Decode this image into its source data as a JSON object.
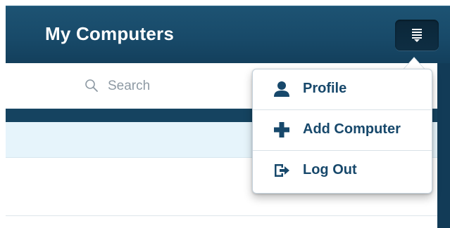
{
  "header": {
    "title": "My Computers",
    "menu_icon": "menu-list-icon"
  },
  "search": {
    "icon": "search-icon",
    "placeholder": "Search"
  },
  "dropdown_menu": {
    "items": [
      {
        "label": "Profile",
        "icon": "person-icon"
      },
      {
        "label": "Add Computer",
        "icon": "plus-icon"
      },
      {
        "label": "Log Out",
        "icon": "logout-icon"
      }
    ]
  },
  "colors": {
    "header_bg": "#184a69",
    "menu_button_bg": "#0e2e43",
    "menu_text": "#17486b",
    "selected_row_bg": "#e6f4fb",
    "search_placeholder": "#8e9aa4"
  }
}
